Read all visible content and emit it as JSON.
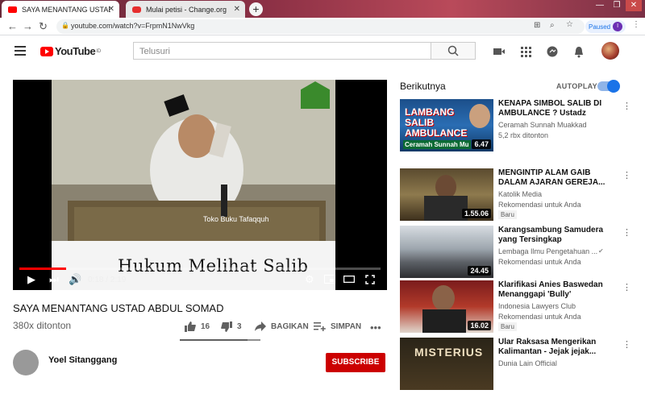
{
  "browser": {
    "tabs": [
      {
        "title": "SAYA MENANTANG USTAD ABDUL",
        "close": "✕"
      },
      {
        "title": "Mulai petisi - Change.org",
        "close": "✕"
      }
    ],
    "new_tab": "+",
    "window_buttons": [
      "—",
      "❐",
      "✕"
    ],
    "url": "youtube.com/watch?v=FrpmN1NwVkg",
    "profile_status": "Paused",
    "profile_initial": "I"
  },
  "youtube": {
    "logo_text": "YouTube",
    "logo_sup": "ID",
    "search_placeholder": "Telusuri"
  },
  "player": {
    "subtitle": "Hukum Melihat Salib",
    "overlay_text": "Toko Buku Tafaqquh",
    "current_time": "0:18",
    "duration": "2:19",
    "time_display": "0:18 / 2:19",
    "progress_fraction": 0.13
  },
  "video": {
    "title": "SAYA MENANTANG USTAD ABDUL SOMAD",
    "views": "380x ditonton",
    "likes": "16",
    "dislikes": "3",
    "share_label": "BAGIKAN",
    "save_label": "SIMPAN",
    "like_ratio": 0.84
  },
  "channel": {
    "name": "Yoel Sitanggang",
    "subscribe_label": "SUBSCRIBE"
  },
  "sidebar": {
    "up_next": "Berikutnya",
    "autoplay_label": "AUTOPLAY",
    "autoplay_on": true,
    "items": [
      {
        "title": "KENAPA SIMBOL SALIB DI AMBULANCE ? Ustadz Abdul...",
        "channel": "Ceramah Sunnah Muakkad",
        "meta": "5,2 rbx ditonton",
        "badge": "",
        "duration": "6.47",
        "thumb_text": "LAMBANG SALIB AMBULANCE",
        "thumb_caption": "Ceramah Sunnah Mu"
      },
      {
        "title": "MENGINTIP ALAM GAIB DALAM AJARAN GEREJA...",
        "channel": "Katolik Media",
        "meta": "Rekomendasi untuk Anda",
        "badge": "Baru",
        "duration": "1.55.06",
        "thumb_text": "",
        "thumb_caption": ""
      },
      {
        "title": "Karangsambung Samudera yang Tersingkap",
        "channel": "Lembaga Ilmu Pengetahuan ...",
        "meta": "Rekomendasi untuk Anda",
        "badge": "",
        "duration": "24.45",
        "thumb_text": "",
        "thumb_caption": ""
      },
      {
        "title": "Klarifikasi Anies Baswedan Menanggapi 'Bully' Terhadap...",
        "channel": "Indonesia Lawyers Club",
        "meta": "Rekomendasi untuk Anda",
        "badge": "Baru",
        "duration": "16.02",
        "thumb_text": "",
        "thumb_caption": ""
      },
      {
        "title": "Ular Raksasa Mengerikan Kalimantan - Jejak jejak...",
        "channel": "Dunia Lain Official",
        "meta": "",
        "badge": "",
        "duration": "",
        "thumb_text": "MISTERIUS",
        "thumb_caption": ""
      }
    ]
  },
  "colors": {
    "youtube_red": "#ff0000",
    "subscribe_red": "#cc0000",
    "autoplay_blue": "#1a73e8"
  }
}
